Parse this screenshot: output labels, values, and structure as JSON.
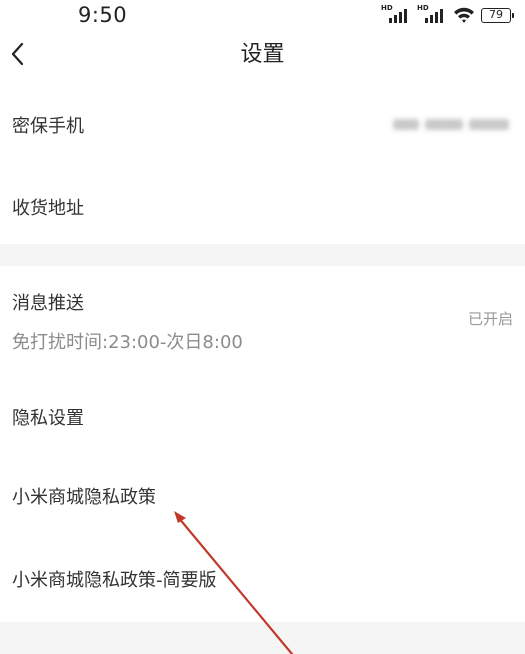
{
  "status_bar": {
    "time": "9:50",
    "battery": "79",
    "signal_label": "HD"
  },
  "header": {
    "title": "设置"
  },
  "settings": {
    "security_phone": {
      "label": "密保手机"
    },
    "shipping_address": {
      "label": "收货地址"
    },
    "push_notifications": {
      "label": "消息推送",
      "dnd": "免打扰时间:23:00-次日8:00",
      "status": "已开启"
    },
    "privacy_settings": {
      "label": "隐私设置"
    },
    "privacy_policy": {
      "label": "小米商城隐私政策"
    },
    "privacy_policy_brief": {
      "label": "小米商城隐私政策-简要版"
    }
  },
  "colors": {
    "band": "#f5f5f5",
    "text": "#333333",
    "secondary_text": "#8c8c8c",
    "arrow": "#c0392b"
  }
}
